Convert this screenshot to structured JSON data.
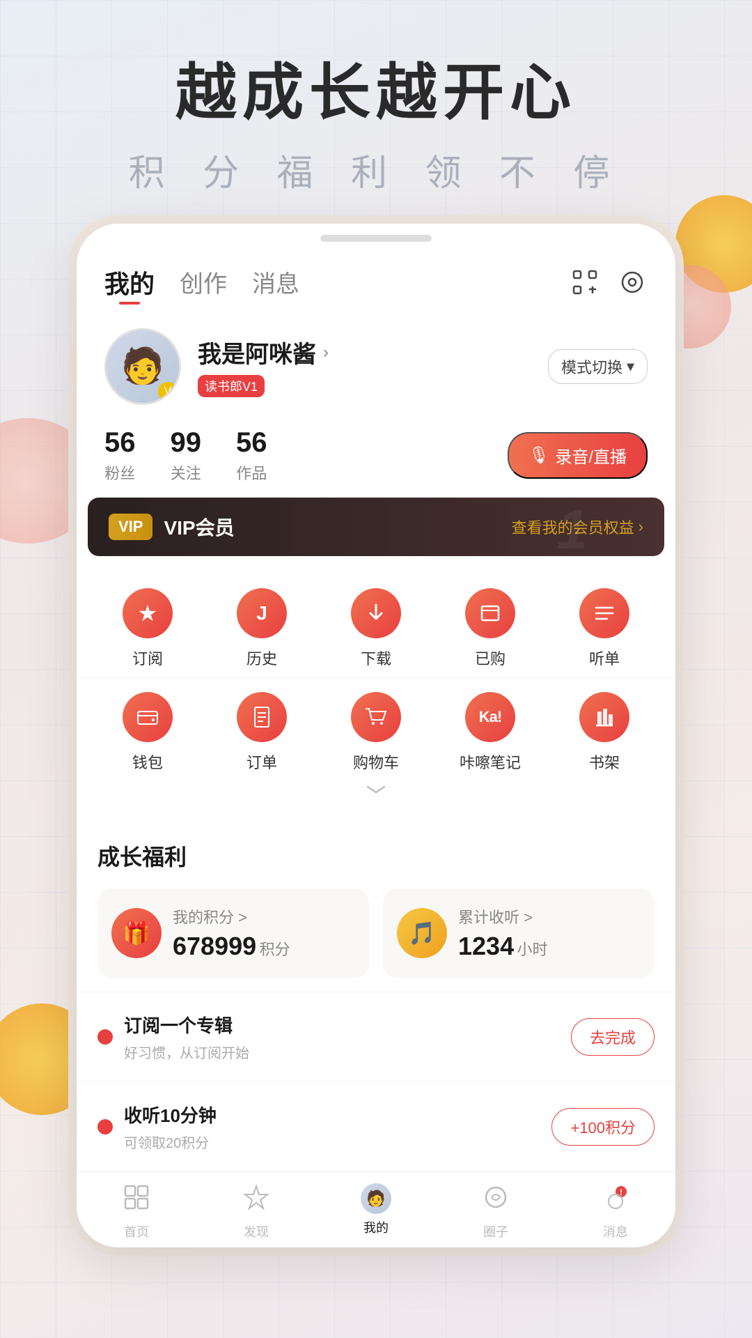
{
  "hero": {
    "title": "越成长越开心",
    "subtitle": "积 分 福 利 领 不 停"
  },
  "nav": {
    "tab_mine": "我的",
    "tab_create": "创作",
    "tab_message": "消息",
    "scan_icon": "⊡",
    "settings_icon": "◎"
  },
  "profile": {
    "username": "我是阿咪酱",
    "username_arrow": ">",
    "mode_switch": "模式切换",
    "mode_switch_arrow": "▾",
    "badge_text": "读书郎V1",
    "fans_count": "56",
    "fans_label": "粉丝",
    "follow_count": "99",
    "follow_label": "关注",
    "works_count": "56",
    "works_label": "作品",
    "record_btn": "录音/直播",
    "mic_icon": "🎙"
  },
  "vip": {
    "badge": "VIP",
    "text": "VIP会员",
    "rights_text": "查看我的会员权益",
    "rights_arrow": ">"
  },
  "menu_row1": [
    {
      "label": "订阅",
      "icon": "★"
    },
    {
      "label": "历史",
      "icon": "J"
    },
    {
      "label": "下载",
      "icon": "↓"
    },
    {
      "label": "已购",
      "icon": "□"
    },
    {
      "label": "听单",
      "icon": "≡"
    }
  ],
  "menu_row2": [
    {
      "label": "钱包",
      "icon": "👛"
    },
    {
      "label": "订单",
      "icon": "📋"
    },
    {
      "label": "购物车",
      "icon": "🛒"
    },
    {
      "label": "咔嚓笔记",
      "icon": "Ka!"
    },
    {
      "label": "书架",
      "icon": "📚"
    }
  ],
  "expand_icon": "˅",
  "growth": {
    "section_title": "成长福利",
    "points_title": "我的积分 >",
    "points_value": "678999",
    "points_unit": "积分",
    "listen_title": "累计收听 >",
    "listen_value": "1234",
    "listen_unit": "小时"
  },
  "tasks": [
    {
      "title": "订阅一个专辑",
      "desc": "好习惯，从订阅开始",
      "btn_label": "去完成"
    },
    {
      "title": "收听10分钟",
      "desc": "可领取20积分",
      "btn_label": "+100积分"
    }
  ],
  "bottom_nav": [
    {
      "label": "首页",
      "icon": "⊞",
      "active": false
    },
    {
      "label": "发现",
      "icon": "☆",
      "active": false
    },
    {
      "label": "我的",
      "icon": "avatar",
      "active": true
    },
    {
      "label": "圈子",
      "icon": "◯",
      "active": false
    },
    {
      "label": "消息",
      "icon": "🔴",
      "active": false
    }
  ]
}
